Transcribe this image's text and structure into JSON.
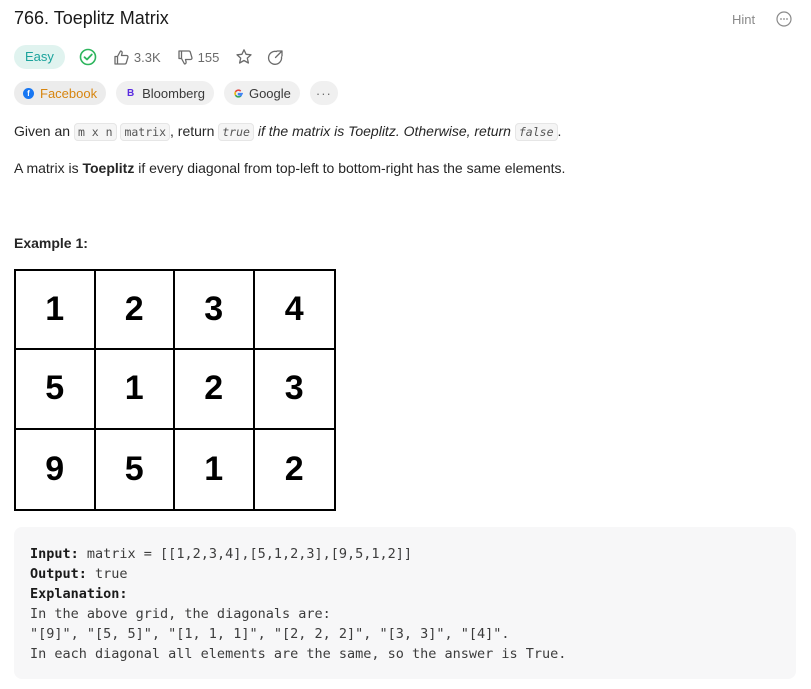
{
  "problem": {
    "title": "766. Toeplitz Matrix",
    "hint_label": "Hint",
    "difficulty": "Easy",
    "likes": "3.3K",
    "dislikes": "155"
  },
  "tags": [
    {
      "label": "Facebook"
    },
    {
      "label": "Bloomberg"
    },
    {
      "label": "Google"
    },
    {
      "label": "···"
    }
  ],
  "description": {
    "p1_given": "Given an ",
    "p1_code_m": "m x n",
    "p1_code_matrix": "matrix",
    "p1_return": ", return ",
    "p1_code_true": "true",
    "p1_if": " if the matrix is Toeplitz. Otherwise, return ",
    "p1_code_false": "false",
    "p1_end": ".",
    "p2_start": "A matrix is ",
    "p2_bold": "Toeplitz",
    "p2_end": " if every diagonal from top-left to bottom-right has the same elements."
  },
  "example": {
    "title": "Example 1:",
    "grid": [
      [
        "1",
        "2",
        "3",
        "4"
      ],
      [
        "5",
        "1",
        "2",
        "3"
      ],
      [
        "9",
        "5",
        "1",
        "2"
      ]
    ],
    "input_label": "Input:",
    "input_value": " matrix = [[1,2,3,4],[5,1,2,3],[9,5,1,2]]",
    "output_label": "Output:",
    "output_value": " true",
    "explanation_label": "Explanation:",
    "explanation_lines": [
      "In the above grid, the diagonals are:",
      "\"[9]\", \"[5, 5]\", \"[1, 1, 1]\", \"[2, 2, 2]\", \"[3, 3]\", \"[4]\".",
      "In each diagonal all elements are the same, so the answer is True."
    ]
  },
  "colors": {
    "easy_text": "#1ba39c",
    "easy_bg": "#e0f3ef",
    "active_tag": "#d7850f",
    "facebook_logo": "#1877f2",
    "bloomberg_logo": "#5a2be0",
    "solved_check": "#2db55d"
  },
  "icons": [
    "solved-check-icon",
    "thumb-up-icon",
    "thumb-down-icon",
    "star-icon",
    "share-icon",
    "more-options-icon"
  ]
}
